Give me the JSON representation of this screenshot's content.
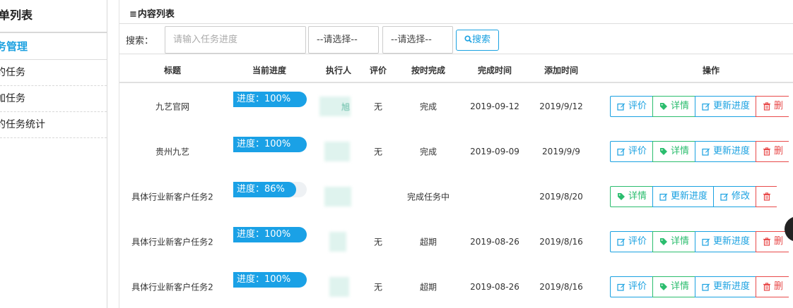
{
  "sidebar": {
    "title": "单列表",
    "group": "务管理",
    "items": [
      {
        "label": "的任务"
      },
      {
        "label": "加任务"
      },
      {
        "label": "的任务统计"
      }
    ]
  },
  "panel": {
    "title_icon": "≡",
    "title": "内容列表"
  },
  "search": {
    "label": "搜索：",
    "placeholder": "请输入任务进度",
    "select1": "--请选择--",
    "select2": "--请选择--",
    "button_label": "搜索"
  },
  "table": {
    "headers": [
      "标题",
      "当前进度",
      "执行人",
      "评价",
      "按时完成",
      "完成时间",
      "添加时间",
      "操作"
    ],
    "rows": [
      {
        "title": "九艺官网",
        "progress_text": "进度：100%",
        "progress": 1.0,
        "assignee": "旭",
        "rating": "无",
        "on_time": "完成",
        "finish_time": "2019-09-12",
        "add_time": "2019/9/12",
        "actions": [
          {
            "label": "评价",
            "icon": "edit-icon",
            "color": "blue"
          },
          {
            "label": "详情",
            "icon": "tag-icon",
            "color": "green"
          },
          {
            "label": "更新进度",
            "icon": "edit-icon",
            "color": "blue"
          },
          {
            "label": "删",
            "icon": "trash-icon",
            "color": "red"
          }
        ]
      },
      {
        "title": "贵州九艺",
        "progress_text": "进度：100%",
        "progress": 1.0,
        "assignee": "",
        "rating": "无",
        "on_time": "完成",
        "finish_time": "2019-09-09",
        "add_time": "2019/9/9",
        "actions": [
          {
            "label": "评价",
            "icon": "edit-icon",
            "color": "blue"
          },
          {
            "label": "详情",
            "icon": "tag-icon",
            "color": "green"
          },
          {
            "label": "更新进度",
            "icon": "edit-icon",
            "color": "blue"
          },
          {
            "label": "删",
            "icon": "trash-icon",
            "color": "red"
          }
        ]
      },
      {
        "title": "具体行业新客户任务2",
        "progress_text": "进度：86%",
        "progress": 0.86,
        "assignee": "",
        "rating": "",
        "on_time": "完成任务中",
        "finish_time": "",
        "add_time": "2019/8/20",
        "actions": [
          {
            "label": "详情",
            "icon": "tag-icon",
            "color": "green"
          },
          {
            "label": "更新进度",
            "icon": "edit-icon",
            "color": "blue"
          },
          {
            "label": "修改",
            "icon": "edit-icon",
            "color": "blue"
          },
          {
            "label": "",
            "icon": "trash-icon",
            "color": "red"
          }
        ]
      },
      {
        "title": "具体行业新客户任务2",
        "progress_text": "进度：100%",
        "progress": 1.0,
        "assignee": "",
        "rating": "无",
        "on_time": "超期",
        "finish_time": "2019-08-26",
        "add_time": "2019/8/16",
        "actions": [
          {
            "label": "评价",
            "icon": "edit-icon",
            "color": "blue"
          },
          {
            "label": "详情",
            "icon": "tag-icon",
            "color": "green"
          },
          {
            "label": "更新进度",
            "icon": "edit-icon",
            "color": "blue"
          },
          {
            "label": "删",
            "icon": "trash-icon",
            "color": "red"
          }
        ]
      },
      {
        "title": "具体行业新客户任务2",
        "progress_text": "进度：100%",
        "progress": 1.0,
        "assignee": "",
        "rating": "无",
        "on_time": "超期",
        "finish_time": "2019-08-26",
        "add_time": "2019/8/16",
        "actions": [
          {
            "label": "评价",
            "icon": "edit-icon",
            "color": "blue"
          },
          {
            "label": "详情",
            "icon": "tag-icon",
            "color": "green"
          },
          {
            "label": "更新进度",
            "icon": "edit-icon",
            "color": "blue"
          },
          {
            "label": "删",
            "icon": "trash-icon",
            "color": "red"
          }
        ]
      }
    ]
  },
  "colors": {
    "accent": "#1aa1e1",
    "success": "#2bbd6e",
    "danger": "#e84a4a",
    "progress": "#1aa1e6"
  }
}
